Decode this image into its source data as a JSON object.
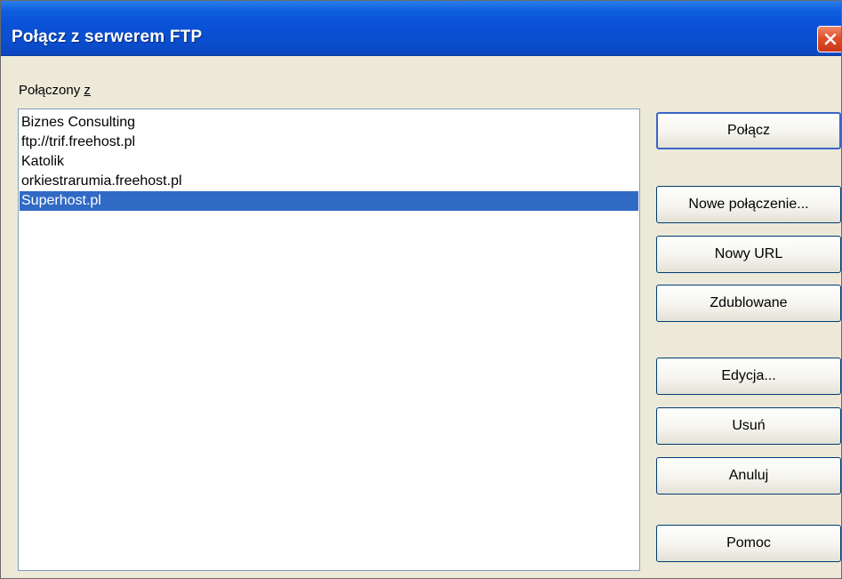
{
  "window": {
    "title": "Połącz z serwerem FTP"
  },
  "connections": {
    "label_prefix": "Połączony ",
    "label_accel": "z",
    "items": [
      {
        "label": "Biznes Consulting",
        "selected": false
      },
      {
        "label": "ftp://trif.freehost.pl",
        "selected": false
      },
      {
        "label": "Katolik",
        "selected": false
      },
      {
        "label": "orkiestrarumia.freehost.pl",
        "selected": false
      },
      {
        "label": "Superhost.pl",
        "selected": true
      }
    ]
  },
  "buttons": {
    "connect": "Połącz",
    "new_connection": "Nowe połączenie...",
    "new_url": "Nowy URL",
    "duplicate": "Zdublowane",
    "edit": "Edycja...",
    "delete": "Usuń",
    "cancel": "Anuluj",
    "help": "Pomoc"
  },
  "colors": {
    "titlebar": "#0a52d8",
    "selection": "#316ac5",
    "dialog_bg": "#ece9d8",
    "close_button": "#e0502a"
  }
}
